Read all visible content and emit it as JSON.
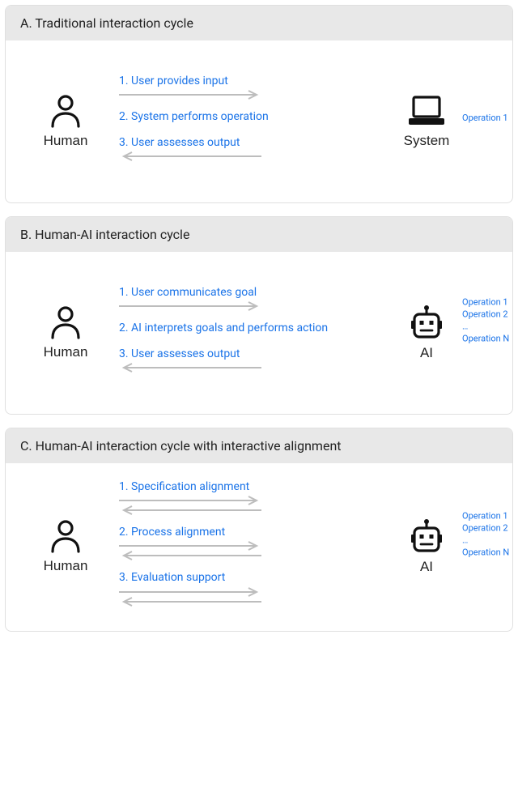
{
  "panels": [
    {
      "id": "A",
      "title": "A. Traditional interaction cycle",
      "left_actor": "Human",
      "right_actor": "System",
      "right_actor_type": "laptop",
      "steps": [
        {
          "text": "1. User provides input",
          "arrows": [
            "right"
          ]
        },
        {
          "text": "2. System performs operation",
          "arrows": []
        },
        {
          "text": "3. User assesses output",
          "arrows": [
            "left"
          ]
        }
      ],
      "operations": [
        "Operation 1"
      ]
    },
    {
      "id": "B",
      "title": "B. Human-AI interaction cycle",
      "left_actor": "Human",
      "right_actor": "AI",
      "right_actor_type": "robot",
      "steps": [
        {
          "text": "1. User communicates goal",
          "arrows": [
            "right"
          ]
        },
        {
          "text": "2. AI interprets goals and performs action",
          "arrows": []
        },
        {
          "text": "3. User assesses output",
          "arrows": [
            "left"
          ]
        }
      ],
      "operations": [
        "Operation 1",
        "Operation 2",
        "…",
        "Operation N"
      ]
    },
    {
      "id": "C",
      "title": "C. Human-AI interaction cycle with interactive alignment",
      "left_actor": "Human",
      "right_actor": "AI",
      "right_actor_type": "robot",
      "steps": [
        {
          "text": "1. Specification alignment",
          "arrows": [
            "right",
            "left"
          ]
        },
        {
          "text": "2. Process alignment",
          "arrows": [
            "right",
            "left"
          ]
        },
        {
          "text": "3. Evaluation support",
          "arrows": [
            "right",
            "left"
          ]
        }
      ],
      "operations": [
        "Operation 1",
        "Operation 2",
        "…",
        "Operation N"
      ]
    }
  ]
}
